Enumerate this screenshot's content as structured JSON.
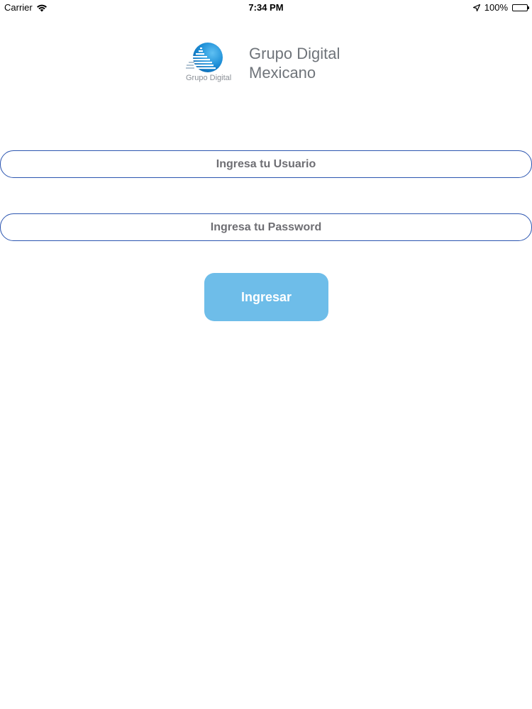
{
  "status_bar": {
    "carrier": "Carrier",
    "time": "7:34 PM",
    "battery": "100%",
    "icons": [
      "wifi-icon",
      "location-arrow-icon",
      "battery-icon"
    ]
  },
  "logo": {
    "mark_caption": "Grupo Digital",
    "wordmark_line1": "Grupo Digital",
    "wordmark_line2": "Mexicano"
  },
  "form": {
    "username_placeholder": "Ingresa tu Usuario",
    "username_value": "",
    "password_placeholder": "Ingresa tu Password",
    "password_value": "",
    "submit_label": "Ingresar"
  },
  "colors": {
    "field_border": "#2b55b0",
    "button_bg": "#6ebde9",
    "logo_blue": "#1e90d8",
    "logo_text": "#6f747a"
  }
}
